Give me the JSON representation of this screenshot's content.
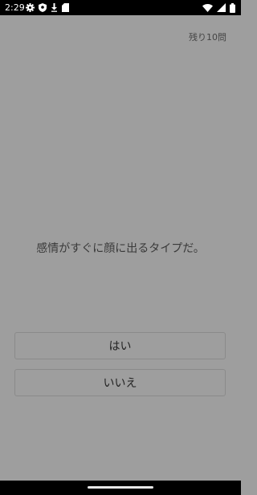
{
  "status_bar": {
    "time": "2:29",
    "left_icons": [
      "gear-icon",
      "shield-icon",
      "download-arrow-icon",
      "sd-card-icon"
    ],
    "right_icons": [
      "wifi-icon",
      "cellular-signal-icon",
      "battery-icon"
    ]
  },
  "quiz": {
    "remaining": "残り10問",
    "question": "感情がすぐに顔に出るタイプだ。",
    "answers": {
      "yes": "はい",
      "no": "いいえ"
    }
  },
  "colors": {
    "background": "#9e9e9e",
    "status_bar": "#000000",
    "button_border": "#8a8a8a",
    "text": "#3a3a3a"
  }
}
